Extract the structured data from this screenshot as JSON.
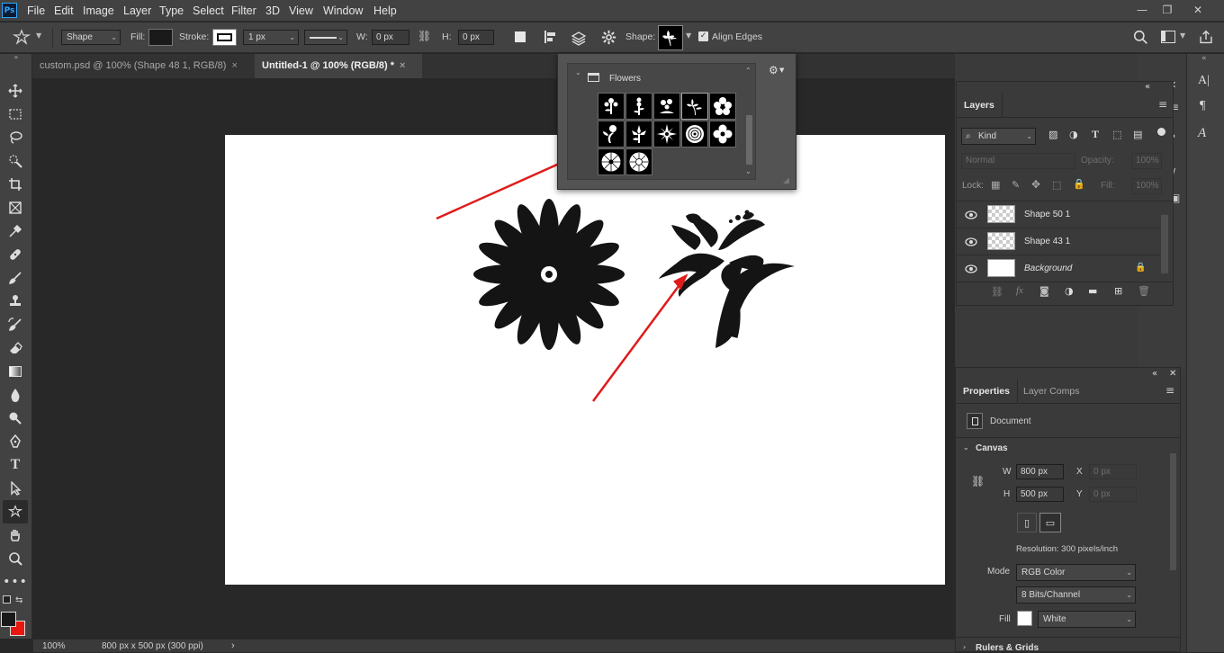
{
  "app": {
    "logo": "Ps"
  },
  "menu": [
    "File",
    "Edit",
    "Image",
    "Layer",
    "Type",
    "Select",
    "Filter",
    "3D",
    "View",
    "Window",
    "Help"
  ],
  "window_controls": {
    "minimize": "—",
    "restore": "❐",
    "close": "✕"
  },
  "options": {
    "mode": "Shape",
    "fill_label": "Fill:",
    "stroke_label": "Stroke:",
    "stroke_width": "1 px",
    "w_label": "W:",
    "w_value": "0 px",
    "h_label": "H:",
    "h_value": "0 px",
    "shape_label": "Shape:",
    "align_edges": "Align Edges"
  },
  "tabs": [
    {
      "label": "custom.psd @ 100% (Shape 48 1, RGB/8)",
      "close": "×"
    },
    {
      "label": "Untitled-1 @ 100% (RGB/8) *",
      "close": "×"
    }
  ],
  "shape_picker": {
    "folder": "Flowers",
    "gear": "⚙"
  },
  "layers": {
    "title": "Layers",
    "kind": "Kind",
    "blend": "Normal",
    "opacity_label": "Opacity:",
    "opacity_value": "100%",
    "lock_label": "Lock:",
    "fill_label": "Fill:",
    "fill_value": "100%",
    "items": [
      {
        "name": "Shape 50 1"
      },
      {
        "name": "Shape 43 1"
      },
      {
        "name": "Background"
      }
    ]
  },
  "properties": {
    "tab1": "Properties",
    "tab2": "Layer Comps",
    "doc_label": "Document",
    "canvas_section": "Canvas",
    "w_label": "W",
    "w_value": "800 px",
    "x_label": "X",
    "x_value": "0 px",
    "h_label": "H",
    "h_value": "500 px",
    "y_label": "Y",
    "y_value": "0 px",
    "resolution": "Resolution: 300 pixels/inch",
    "mode_label": "Mode",
    "mode_value": "RGB Color",
    "bits_value": "8 Bits/Channel",
    "fill_label": "Fill",
    "fill_value": "White",
    "rulers_section": "Rulers & Grids"
  },
  "status": {
    "zoom": "100%",
    "doc_info": "800 px x 500 px (300 ppi)",
    "arrow": "›"
  },
  "colors": {
    "accent": "#31a8ff",
    "annotation": "#e01b1b",
    "foreground": "#1a1a1a",
    "background": "#e8170f"
  }
}
